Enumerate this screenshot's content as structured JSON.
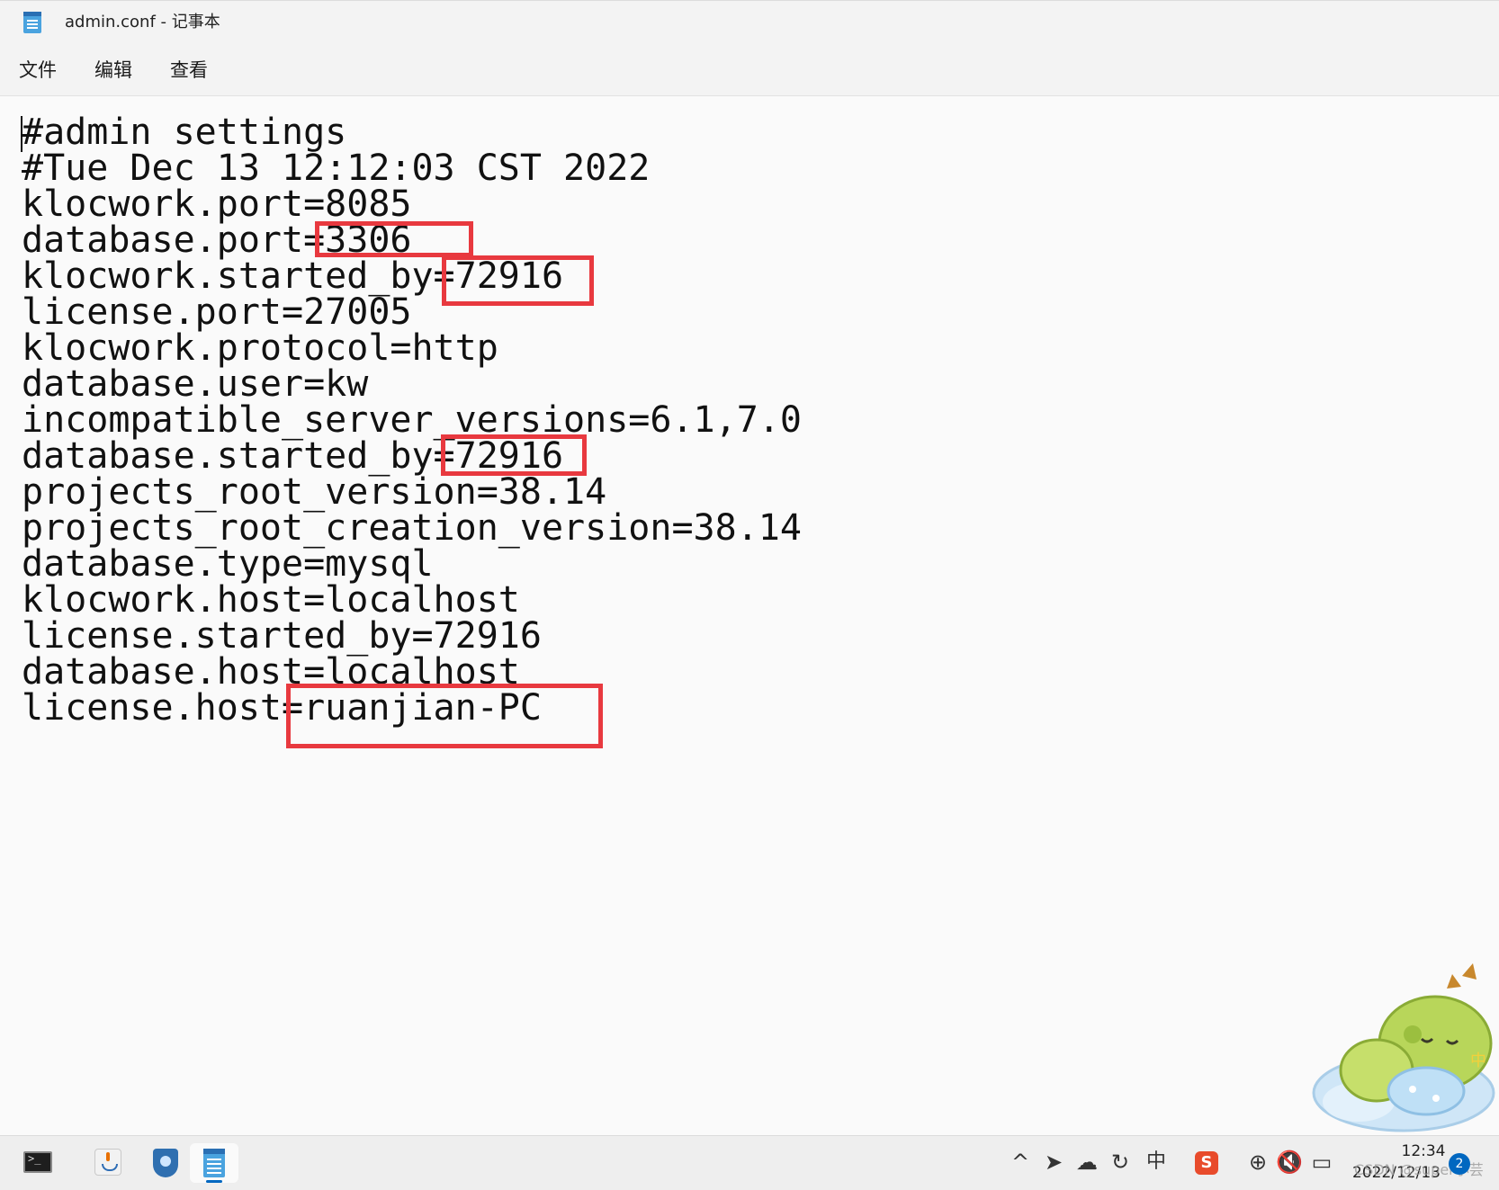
{
  "window": {
    "title": "admin.conf - 记事本",
    "app_icon": "notepad-icon"
  },
  "menu": {
    "items": [
      "文件",
      "编辑",
      "查看"
    ]
  },
  "editor": {
    "content": "#admin settings\n#Tue Dec 13 12:12:03 CST 2022\nklocwork.port=8085\ndatabase.port=3306\nklocwork.started_by=72916\nlicense.port=27005\nklocwork.protocol=http\ndatabase.user=kw\nincompatible_server_versions=6.1,7.0\ndatabase.started_by=72916\nprojects_root_version=38.14\nprojects_root_creation_version=38.14\ndatabase.type=mysql\nklocwork.host=localhost\nlicense.started_by=72916\ndatabase.host=localhost\nlicense.host=ruanjian-PC",
    "highlight_color": "#e8393f",
    "highlighted_values": [
      "3306",
      "72916",
      "72916",
      "ruanjian-PC"
    ]
  },
  "taskbar": {
    "apps": [
      "terminal-icon",
      "java-icon",
      "shield-app-icon",
      "notepad-icon"
    ],
    "active_app": "notepad-icon",
    "tray": {
      "ime_label": "中",
      "sogou_label": "S",
      "time": "12:34",
      "date": "2022/12/13",
      "notification_count": "2"
    },
    "watermark": "CSDN @super小芸"
  }
}
